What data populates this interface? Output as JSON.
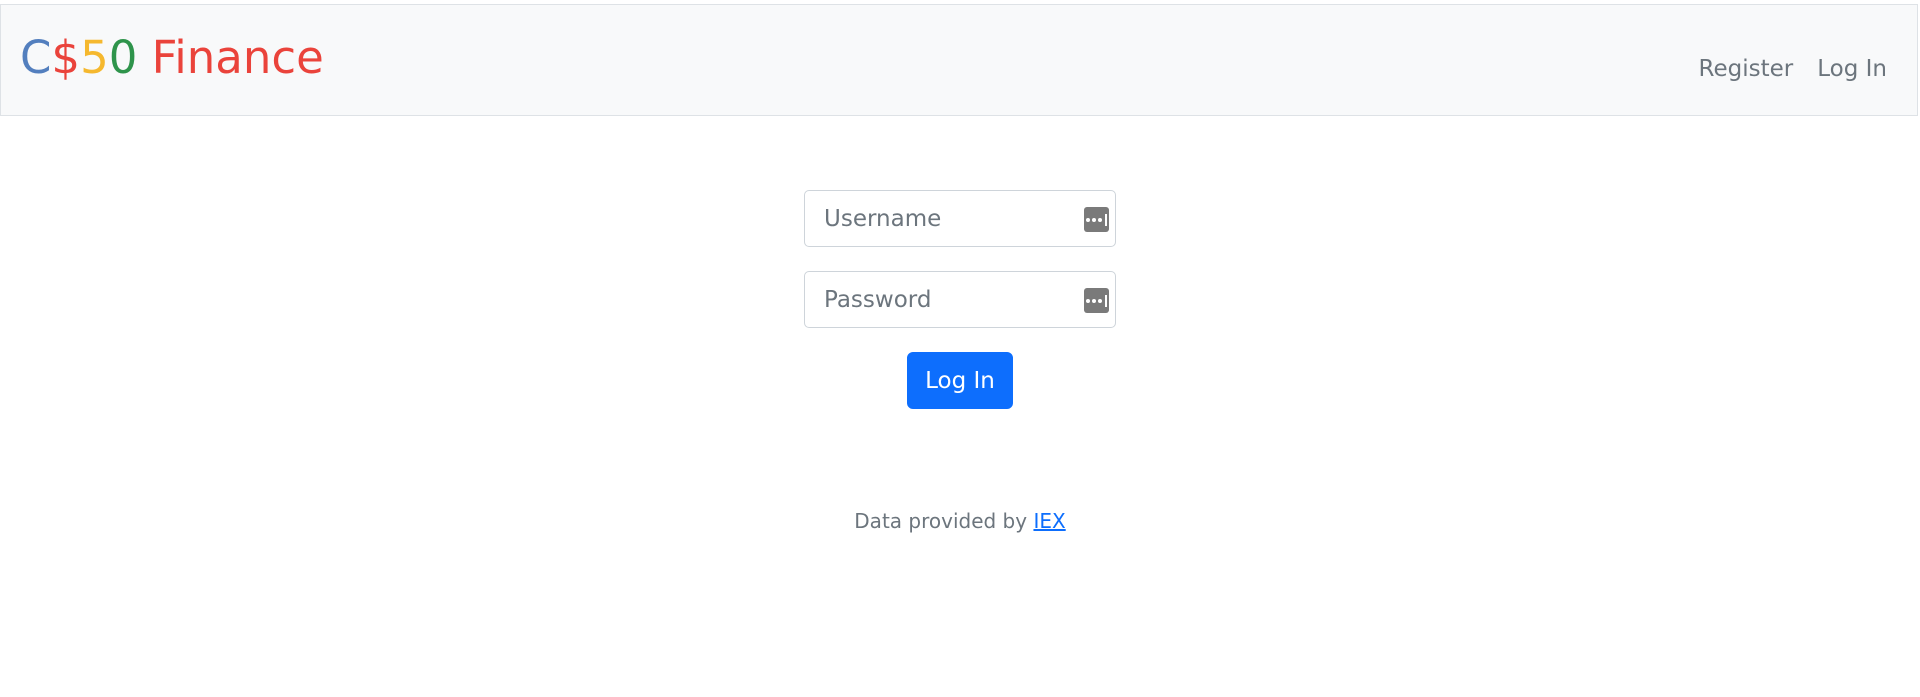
{
  "brand": {
    "parts": [
      "C",
      "$",
      "5",
      "0",
      " Finance"
    ]
  },
  "nav": {
    "register_label": "Register",
    "login_label": "Log In"
  },
  "form": {
    "username_placeholder": "Username",
    "password_placeholder": "Password",
    "submit_label": "Log In"
  },
  "footer": {
    "text": "Data provided by",
    "link_label": "IEX"
  },
  "colors": {
    "brand_blue": "#537fbe",
    "brand_red": "#ea433b",
    "brand_yellow": "#f5b82e",
    "brand_green": "#2e944b",
    "primary": "#0d6efd"
  },
  "icons": {
    "password_manager": "password-manager-icon"
  }
}
